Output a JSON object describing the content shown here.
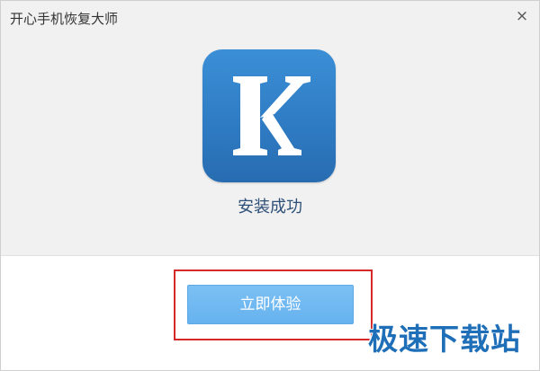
{
  "window": {
    "title": "开心手机恢复大师",
    "close_glyph": "×"
  },
  "logo": {
    "letter": "K",
    "icon": "app-logo-k"
  },
  "status": {
    "text": "安装成功"
  },
  "action": {
    "button_label": "立即体验"
  },
  "watermark": {
    "text": "极速下载站"
  },
  "colors": {
    "brand_blue": "#2f7cc4",
    "button_blue": "#6ab4f0",
    "highlight_red": "#d6292a",
    "status_text": "#2d4f78"
  }
}
